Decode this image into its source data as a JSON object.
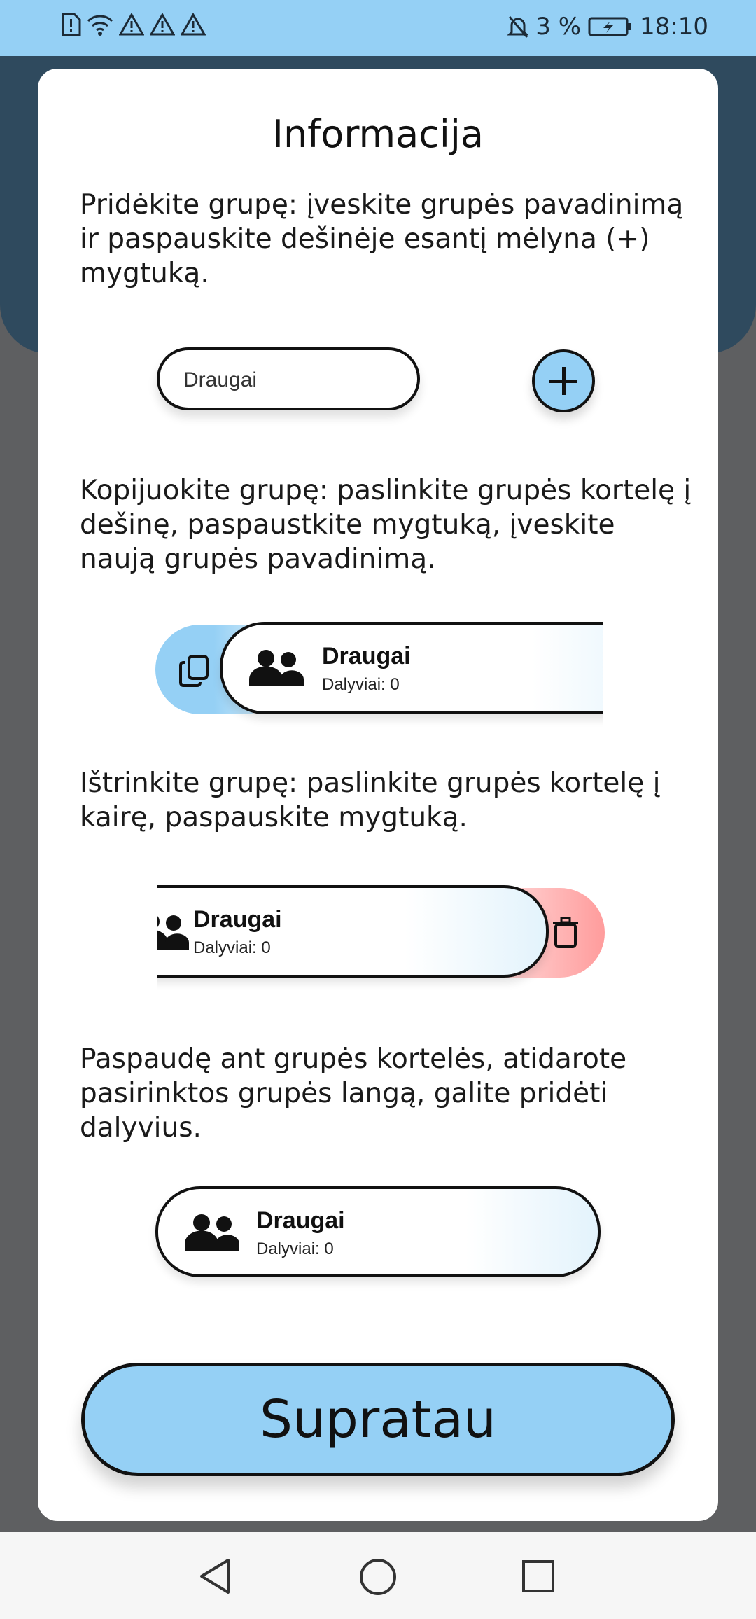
{
  "status_bar": {
    "battery_percent": "3 %",
    "time": "18:10",
    "left_icons": [
      "sim-alert-icon",
      "wifi-icon",
      "warning-icon",
      "warning-icon",
      "warning-icon"
    ],
    "right_icons": [
      "bell-off-icon",
      "battery-charging-icon"
    ]
  },
  "dialog": {
    "title": "Informacija",
    "add_text": "Pridėkite grupę: įveskite grupės pavadinimą ir paspauskite dešinėje esantį mėlyna (+) mygtuką.",
    "add_demo_input_value": "Draugai",
    "copy_text": "Kopijuokite grupę: paslinkite grupės kortelę į dešinę, paspaustkite mygtuką, įveskite naują grupės pavadinimą.",
    "delete_text": "Ištrinkite grupę: paslinkite grupės kortelę į kairę, paspauskite mygtuką.",
    "open_text": "Paspaudę ant grupės kortelės, atidarote pasirinktos grupės langą, galite pridėti dalyvius.",
    "card_name": "Draugai",
    "card_sub": "Dalyviai: 0",
    "ok_button": "Supratau"
  },
  "colors": {
    "accent": "#95d0f5",
    "delete": "#ff9c9c",
    "header_bg": "#2f4a5e"
  }
}
